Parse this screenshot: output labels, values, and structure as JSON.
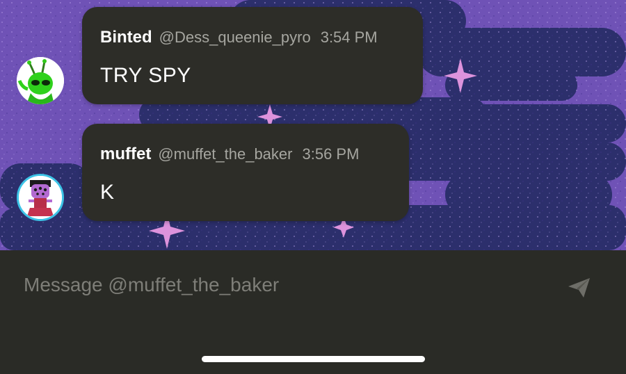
{
  "messages": [
    {
      "author": "Binted",
      "handle": "@Dess_queenie_pyro",
      "time": "3:54 PM",
      "text": "TRY SPY",
      "avatar_icon": "green-alien-avatar"
    },
    {
      "author": "muffet",
      "handle": "@muffet_the_baker",
      "time": "3:56 PM",
      "text": "K",
      "avatar_icon": "muffet-spider-avatar"
    }
  ],
  "composer": {
    "placeholder": "Message @muffet_the_baker",
    "send_icon": "send-icon"
  },
  "colors": {
    "background_purple": "#6f52b6",
    "cloud_navy": "#2b2f6b",
    "star_pink": "#d98ad8",
    "bubble": "#2d2d28",
    "composer": "#2a2b26"
  }
}
